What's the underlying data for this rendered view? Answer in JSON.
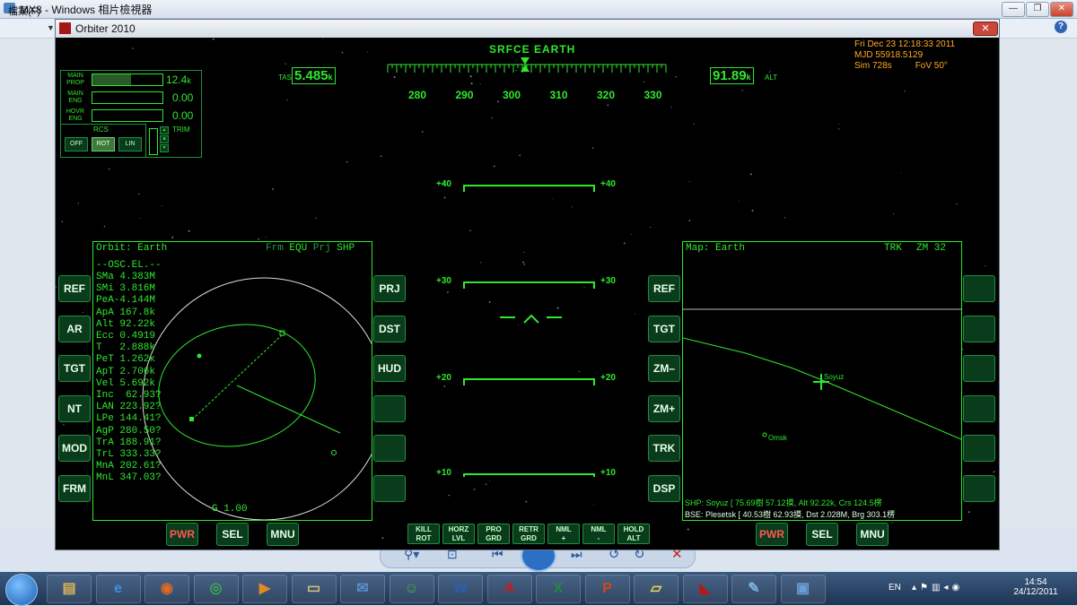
{
  "photo_viewer": {
    "title": "MX8 - Windows 相片檢視器",
    "menu_file": "檔案(F)",
    "help": "?"
  },
  "orbiter": {
    "title": "Orbiter 2010",
    "close": "✕"
  },
  "hud": {
    "mode": "SRFCE EARTH",
    "tas_label": "TAS",
    "tas_value": "5.485",
    "tas_unit": "k",
    "alt_value": "91.89",
    "alt_unit": "k",
    "alt_label": "ALT",
    "heading_ticks": [
      "280",
      "290",
      "300",
      "310",
      "320",
      "330"
    ],
    "pitch_ladder": [
      "+40",
      "+30",
      "+20",
      "+10"
    ]
  },
  "info": {
    "date": "Fri Dec 23 12:18:33 2011",
    "mjd": "MJD 55918.5129",
    "sim": "Sim  728s",
    "fov": "FoV  50°"
  },
  "engine_panel": {
    "main_prop": {
      "label1": "MAIN",
      "label2": "PROP",
      "value": "12.4",
      "unit": "k",
      "level": 0.55
    },
    "main_eng": {
      "label1": "MAIN",
      "label2": "ENG",
      "value": "0.00",
      "level": 0
    },
    "hovr_eng": {
      "label1": "HOVR",
      "label2": "ENG",
      "value": "0.00",
      "level": 0
    },
    "rcs_label": "RCS",
    "rcs_off": "OFF",
    "rcs_rot": "ROT",
    "rcs_lin": "LIN",
    "trim_label": "TRIM"
  },
  "left_mfd": {
    "title": "Orbit: Earth",
    "frm_label": "Frm",
    "frm_value": "EQU",
    "prj_label": "Prj",
    "prj_value": "SHP",
    "section": "--OSC.EL.--",
    "elements": [
      "SMa 4.383M",
      "SMi 3.816M",
      "PeA-4.144M",
      "ApA 167.8k",
      "Alt 92.22k",
      "Ecc 0.4919",
      "T   2.888k",
      "PeT 1.262k",
      "ApT 2.706k",
      "Vel 5.692k",
      "Inc  62.93?",
      "LAN 223.92?",
      "LPe 144.41?",
      "AgP 280.50?",
      "TrA 188.91?",
      "TrL 333.33?",
      "MnA 202.61?",
      "MnL 347.03?"
    ],
    "footer": "G 1.00",
    "left_buttons": [
      "REF",
      "AR",
      "TGT",
      "NT",
      "MOD",
      "FRM"
    ],
    "right_buttons": [
      "PRJ",
      "DST",
      "HUD",
      "",
      "",
      ""
    ],
    "bottom_buttons": [
      "PWR",
      "SEL",
      "MNU"
    ]
  },
  "right_mfd": {
    "title": "Map: Earth",
    "trk": "TRK",
    "zm": "ZM 32",
    "vessel_label": "Soyuz",
    "base_label": "Omsk",
    "shp_line": "SHP:  Soyuz [ 75.69樹 57.12摸, Alt  92.22k, Crs 124.5楞",
    "bse_line": "BSE:  Plesetsk [ 40.53樹 62.93摸, Dst 2.028M, Brg 303.1楞",
    "left_buttons": [
      "REF",
      "TGT",
      "ZM–",
      "ZM+",
      "TRK",
      "DSP"
    ],
    "right_buttons": [
      "",
      "",
      "",
      "",
      "",
      ""
    ],
    "bottom_buttons": [
      "PWR",
      "SEL",
      "MNU"
    ]
  },
  "hud_buttons": [
    {
      "line1": "KILL",
      "line2": "ROT"
    },
    {
      "line1": "HORZ",
      "line2": "LVL"
    },
    {
      "line1": "PRO",
      "line2": "GRD"
    },
    {
      "line1": "RETR",
      "line2": "GRD"
    },
    {
      "line1": "NML",
      "line2": "+"
    },
    {
      "line1": "NML",
      "line2": "-"
    },
    {
      "line1": "HOLD",
      "line2": "ALT"
    }
  ],
  "taskbar": {
    "lang": "EN",
    "time": "14:54",
    "date": "24/12/2011"
  }
}
